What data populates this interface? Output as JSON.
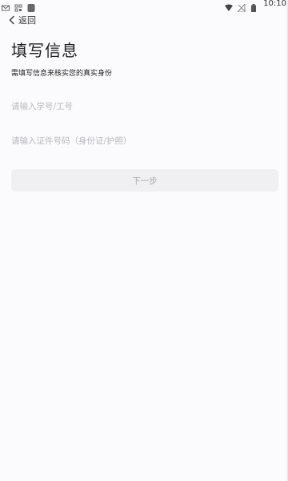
{
  "status_bar": {
    "time": "10:10",
    "left_icons": [
      "mail-icon",
      "qr-icon",
      "app-icon"
    ],
    "right_icons": [
      "wifi-icon",
      "no-signal-icon",
      "battery-icon"
    ]
  },
  "nav": {
    "back_label": "返回"
  },
  "page": {
    "title": "填写信息",
    "subtitle": "需填写信息来核实您的真实身份"
  },
  "form": {
    "student_id_placeholder": "请输入学号/工号",
    "id_number_placeholder": "请输入证件号码（身份证/护照）",
    "next_label": "下一步"
  },
  "colors": {
    "background": "#fbfbfd",
    "placeholder": "#b9b9c0",
    "button_bg": "#f0f0f3",
    "button_text": "#a9a9b0"
  }
}
